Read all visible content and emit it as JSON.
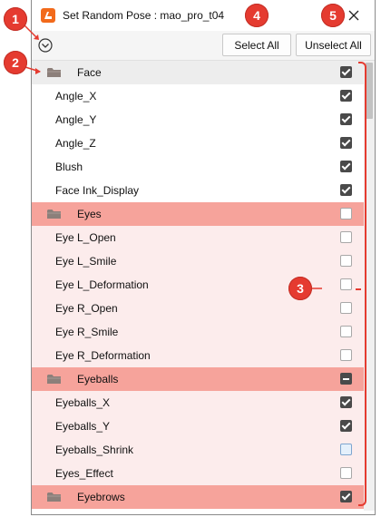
{
  "window": {
    "title": "Set Random Pose : mao_pro_t04",
    "app_icon": "cubism-logo-icon",
    "close_icon": "close-icon"
  },
  "toolbar": {
    "expand_icon": "chevron-down-circle-icon",
    "select_all_label": "Select All",
    "unselect_all_label": "Unselect All"
  },
  "rows": [
    {
      "label": "Face",
      "folder": true,
      "highlight": false,
      "state": "checked"
    },
    {
      "label": "Angle_X",
      "folder": false,
      "highlight": false,
      "state": "checked"
    },
    {
      "label": "Angle_Y",
      "folder": false,
      "highlight": false,
      "state": "checked"
    },
    {
      "label": "Angle_Z",
      "folder": false,
      "highlight": false,
      "state": "checked"
    },
    {
      "label": "Blush",
      "folder": false,
      "highlight": false,
      "state": "checked"
    },
    {
      "label": "Face Ink_Display",
      "folder": false,
      "highlight": false,
      "state": "checked"
    },
    {
      "label": "Eyes",
      "folder": true,
      "highlight": true,
      "state": "unchecked"
    },
    {
      "label": "Eye L_Open",
      "folder": false,
      "highlight": true,
      "state": "unchecked"
    },
    {
      "label": "Eye L_Smile",
      "folder": false,
      "highlight": true,
      "state": "unchecked"
    },
    {
      "label": "Eye L_Deformation",
      "folder": false,
      "highlight": true,
      "state": "unchecked"
    },
    {
      "label": "Eye R_Open",
      "folder": false,
      "highlight": true,
      "state": "unchecked"
    },
    {
      "label": "Eye R_Smile",
      "folder": false,
      "highlight": true,
      "state": "unchecked"
    },
    {
      "label": "Eye R_Deformation",
      "folder": false,
      "highlight": true,
      "state": "unchecked"
    },
    {
      "label": "Eyeballs",
      "folder": true,
      "highlight": true,
      "state": "indeterminate"
    },
    {
      "label": "Eyeballs_X",
      "folder": false,
      "highlight": true,
      "state": "checked"
    },
    {
      "label": "Eyeballs_Y",
      "folder": false,
      "highlight": true,
      "state": "checked"
    },
    {
      "label": "Eyeballs_Shrink",
      "folder": false,
      "highlight": true,
      "state": "light"
    },
    {
      "label": "Eyes_Effect",
      "folder": false,
      "highlight": true,
      "state": "unchecked"
    },
    {
      "label": "Eyebrows",
      "folder": true,
      "highlight": true,
      "state": "checked"
    }
  ],
  "annotations": [
    {
      "number": "1"
    },
    {
      "number": "2"
    },
    {
      "number": "3"
    },
    {
      "number": "4"
    },
    {
      "number": "5"
    }
  ],
  "colors": {
    "annotation_red": "#e53b30",
    "group_highlight": "#f6a39b",
    "item_highlight": "#fcecec",
    "app_orange": "#f26a1b"
  }
}
